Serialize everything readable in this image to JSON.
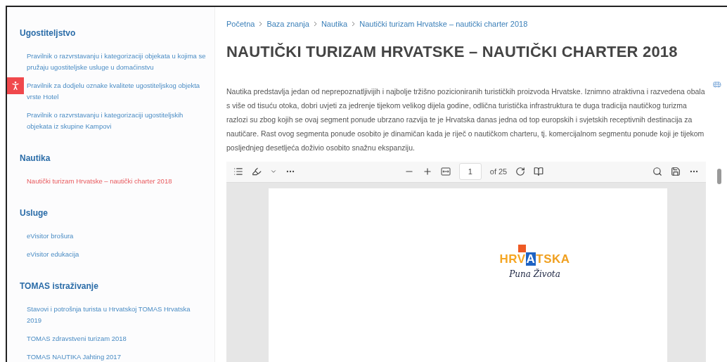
{
  "sidebar": {
    "sections": [
      {
        "heading": "Ugostiteljstvo",
        "items": [
          {
            "label": "Pravilnik o razvrstavanju i kategorizaciji objekata u kojima se pružaju ugostiteljske usluge u domaćinstvu",
            "selected": false
          },
          {
            "label": "Pravilnik za dodjelu oznake kvalitete ugostiteljskog objekta vrste Hotel",
            "selected": false
          },
          {
            "label": "Pravilnik o razvrstavanju i kategorizaciji ugostiteljskih objekata iz skupine Kampovi",
            "selected": false
          }
        ]
      },
      {
        "heading": "Nautika",
        "items": [
          {
            "label": "Nautički turizam Hrvatske – nautički charter 2018",
            "selected": true
          }
        ]
      },
      {
        "heading": "Usluge",
        "items": [
          {
            "label": "eVisitor brošura",
            "selected": false
          },
          {
            "label": "eVisitor edukacija",
            "selected": false
          }
        ]
      },
      {
        "heading": "TOMAS istraživanje",
        "items": [
          {
            "label": "Stavovi i potrošnja turista u Hrvatskoj TOMAS Hrvatska 2019",
            "selected": false
          },
          {
            "label": "TOMAS zdravstveni turizam 2018",
            "selected": false
          },
          {
            "label": "TOMAS NAUTIKA Jahting 2017",
            "selected": false
          }
        ]
      }
    ]
  },
  "breadcrumb": [
    "Početna",
    "Baza znanja",
    "Nautika",
    "Nautički turizam Hrvatske – nautički charter 2018"
  ],
  "title": "NAUTIČKI TURIZAM HRVATSKE – NAUTIČKI CHARTER 2018",
  "intro": "Nautika predstavlja jedan od neprepoznatljivijih i najbolje tržišno pozicioniranih turističkih proizvoda Hrvatske. Iznimno atraktivna i razvedena obala s više od tisuću otoka, dobri uvjeti za jedrenje tijekom velikog dijela godine, odlična turistička infrastruktura te duga tradicija nautičkog turizma razlozi su zbog kojih se ovaj segment ponude ubrzano razvija te je Hrvatska danas jedna od top europskih i svjetskih receptivnih destinacija za nautičare. Rast ovog segmenta ponude osobito je dinamičan kada je riječ o nautičkom charteru, tj. komercijalnom segmentu ponude koji je tijekom posljednjeg desetljeća doživio osobito snažnu ekspanziju.",
  "pdf_viewer": {
    "page": "1",
    "page_count": "of 25",
    "logo": {
      "wordmark": "HRVATSKA",
      "tagline": "Puna Života"
    }
  }
}
